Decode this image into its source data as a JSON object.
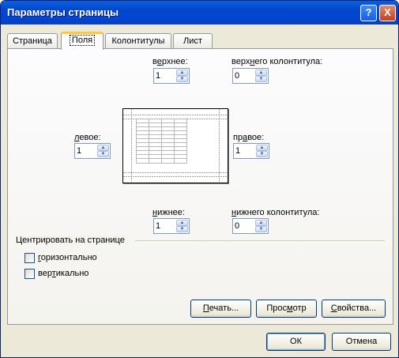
{
  "window": {
    "title": "Параметры страницы",
    "help_button": "?",
    "close_button": "X"
  },
  "tabs": [
    {
      "label": "Страница"
    },
    {
      "label": "Поля"
    },
    {
      "label": "Колонтитулы"
    },
    {
      "label": "Лист"
    }
  ],
  "margins": {
    "top": {
      "label_pre": "в",
      "label_u": "е",
      "label_post": "рхнее:",
      "value": "1"
    },
    "header": {
      "label_pre": "верх",
      "label_u": "н",
      "label_post": "его колонтитула:",
      "value": "0"
    },
    "left": {
      "label_pre": "",
      "label_u": "л",
      "label_post": "евое:",
      "value": "1"
    },
    "right": {
      "label_pre": "пр",
      "label_u": "а",
      "label_post": "вое:",
      "value": "1"
    },
    "bottom": {
      "label_pre": "",
      "label_u": "н",
      "label_post": "ижнее:",
      "value": "1"
    },
    "footer": {
      "label_pre": "",
      "label_u": "н",
      "label_post": "ижнего колонтитула:",
      "value": "0"
    }
  },
  "centering": {
    "title": "Центрировать на странице",
    "horizontal": {
      "label_pre": "",
      "label_u": "г",
      "label_post": "оризонтально",
      "checked": false
    },
    "vertical": {
      "label_pre": "вер",
      "label_u": "т",
      "label_post": "икально",
      "checked": false
    }
  },
  "buttons": {
    "print": {
      "pre": "",
      "u": "П",
      "post": "ечать..."
    },
    "preview": {
      "pre": "Прос",
      "u": "м",
      "post": "отр"
    },
    "properties": {
      "pre": "",
      "u": "С",
      "post": "войства..."
    },
    "ok": "ОК",
    "cancel": "Отмена"
  }
}
